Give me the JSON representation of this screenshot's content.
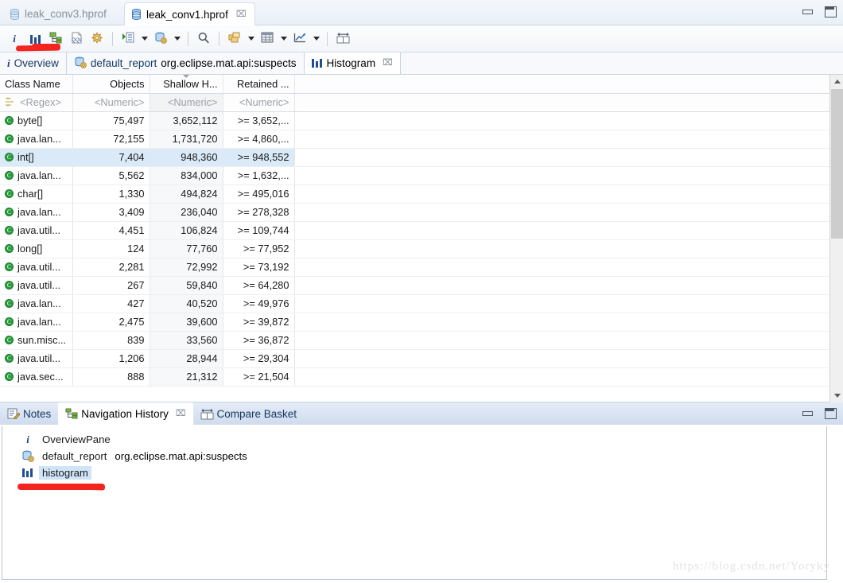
{
  "window": {
    "minimize_label": "Minimize",
    "maximize_label": "Maximize"
  },
  "editor_tabs": [
    {
      "label": "leak_conv3.hprof",
      "icon": "heap-dump-icon",
      "active": false,
      "closable": false
    },
    {
      "label": "leak_conv1.hprof",
      "icon": "heap-dump-icon",
      "active": true,
      "closable": true,
      "close_glyph": "⌧"
    }
  ],
  "toolbar": {
    "items": [
      {
        "name": "overview-info-button",
        "icon": "info-icon",
        "label": "i",
        "pressed": false,
        "dropdown": false
      },
      {
        "name": "histogram-button",
        "icon": "histogram-icon",
        "label": "Histogram",
        "pressed": false,
        "dropdown": false
      },
      {
        "name": "dominator-tree-button",
        "icon": "dominator-tree-icon",
        "label": "Dominator Tree",
        "pressed": false,
        "dropdown": false
      },
      {
        "name": "oql-button",
        "icon": "oql-icon",
        "label": "OQL",
        "pressed": false,
        "dropdown": false
      },
      {
        "name": "calculate-button",
        "icon": "gear-icon",
        "label": "Calculate Precise Retained Size",
        "pressed": false,
        "dropdown": false
      },
      {
        "name": "run-report-button",
        "icon": "run-expert-system-icon",
        "label": "Run Expert System Test",
        "pressed": false,
        "dropdown": true
      },
      {
        "name": "query-browser-button",
        "icon": "query-browser-icon",
        "label": "Query Browser",
        "pressed": false,
        "dropdown": true
      },
      {
        "name": "find-button",
        "icon": "search-icon",
        "label": "Find",
        "pressed": false,
        "dropdown": false
      },
      {
        "name": "group-by-button",
        "icon": "group-by-icon",
        "label": "Group By",
        "pressed": false,
        "dropdown": true
      },
      {
        "name": "export-table-button",
        "icon": "export-table-icon",
        "label": "Export",
        "pressed": false,
        "dropdown": true
      },
      {
        "name": "chart-button",
        "icon": "chart-icon",
        "label": "Chart",
        "pressed": false,
        "dropdown": true
      },
      {
        "name": "compare-button",
        "icon": "compare-basket-icon",
        "label": "Compare",
        "pressed": false,
        "dropdown": false
      }
    ]
  },
  "view_tabs": [
    {
      "label": "Overview",
      "icon": "info-icon",
      "active": false,
      "closable": false,
      "sub": ""
    },
    {
      "label": "default_report",
      "sub": "org.eclipse.mat.api:suspects",
      "icon": "report-icon",
      "active": false,
      "closable": false
    },
    {
      "label": "Histogram",
      "sub": "",
      "icon": "histogram-icon",
      "active": true,
      "closable": true,
      "close_glyph": "⌧"
    }
  ],
  "table": {
    "columns": [
      {
        "key": "class_name",
        "header": "Class Name",
        "align": "left",
        "filter": "<Regex>",
        "filter_icon": "regex-filter-icon",
        "sorted": false
      },
      {
        "key": "objects",
        "header": "Objects",
        "align": "right",
        "filter": "<Numeric>",
        "sorted": false
      },
      {
        "key": "shallow_heap",
        "header": "Shallow H...",
        "align": "right",
        "filter": "<Numeric>",
        "sorted": true,
        "sort_dir": "desc"
      },
      {
        "key": "retained_heap",
        "header": "Retained ...",
        "align": "right",
        "filter": "<Numeric>",
        "sorted": false
      },
      {
        "key": "spacer",
        "header": "",
        "align": "left",
        "filter": "",
        "sorted": false
      }
    ],
    "rows": [
      {
        "icon": "class-icon",
        "class_name": "byte[]",
        "objects": "75,497",
        "shallow_heap": "3,652,112",
        "retained_heap": ">= 3,652,...",
        "selected": false
      },
      {
        "icon": "class-icon",
        "class_name": "java.lan...",
        "objects": "72,155",
        "shallow_heap": "1,731,720",
        "retained_heap": ">= 4,860,...",
        "selected": false
      },
      {
        "icon": "class-icon",
        "class_name": "int[]",
        "objects": "7,404",
        "shallow_heap": "948,360",
        "retained_heap": ">= 948,552",
        "selected": true
      },
      {
        "icon": "class-icon",
        "class_name": "java.lan...",
        "objects": "5,562",
        "shallow_heap": "834,000",
        "retained_heap": ">= 1,632,...",
        "selected": false
      },
      {
        "icon": "class-icon",
        "class_name": "char[]",
        "objects": "1,330",
        "shallow_heap": "494,824",
        "retained_heap": ">= 495,016",
        "selected": false
      },
      {
        "icon": "class-icon",
        "class_name": "java.lan...",
        "objects": "3,409",
        "shallow_heap": "236,040",
        "retained_heap": ">= 278,328",
        "selected": false
      },
      {
        "icon": "class-icon",
        "class_name": "java.util...",
        "objects": "4,451",
        "shallow_heap": "106,824",
        "retained_heap": ">= 109,744",
        "selected": false
      },
      {
        "icon": "class-icon",
        "class_name": "long[]",
        "objects": "124",
        "shallow_heap": "77,760",
        "retained_heap": ">= 77,952",
        "selected": false
      },
      {
        "icon": "class-icon",
        "class_name": "java.util...",
        "objects": "2,281",
        "shallow_heap": "72,992",
        "retained_heap": ">= 73,192",
        "selected": false
      },
      {
        "icon": "class-icon",
        "class_name": "java.util...",
        "objects": "267",
        "shallow_heap": "59,840",
        "retained_heap": ">= 64,280",
        "selected": false
      },
      {
        "icon": "class-icon",
        "class_name": "java.lan...",
        "objects": "427",
        "shallow_heap": "40,520",
        "retained_heap": ">= 49,976",
        "selected": false
      },
      {
        "icon": "class-icon",
        "class_name": "java.lan...",
        "objects": "2,475",
        "shallow_heap": "39,600",
        "retained_heap": ">= 39,872",
        "selected": false
      },
      {
        "icon": "class-icon",
        "class_name": "sun.misc...",
        "objects": "839",
        "shallow_heap": "33,560",
        "retained_heap": ">= 36,872",
        "selected": false
      },
      {
        "icon": "class-icon",
        "class_name": "java.util...",
        "objects": "1,206",
        "shallow_heap": "28,944",
        "retained_heap": ">= 29,304",
        "selected": false
      },
      {
        "icon": "class-icon",
        "class_name": "java.sec...",
        "objects": "888",
        "shallow_heap": "21,312",
        "retained_heap": ">= 21,504",
        "selected": false
      }
    ]
  },
  "scrollbar": {
    "up_glyph": "▲",
    "down_glyph": "▼"
  },
  "bottom_tabs": [
    {
      "label": "Notes",
      "icon": "notes-icon",
      "active": false,
      "closable": false
    },
    {
      "label": "Navigation History",
      "icon": "navigation-history-icon",
      "active": true,
      "closable": true,
      "close_glyph": "⌧"
    },
    {
      "label": "Compare Basket",
      "icon": "compare-basket-icon",
      "active": false,
      "closable": false
    }
  ],
  "navigation_history": [
    {
      "icon": "info-icon",
      "label": "OverviewPane",
      "sub": "",
      "selected": false
    },
    {
      "icon": "report-icon",
      "label": "default_report",
      "sub": "org.eclipse.mat.api:suspects",
      "selected": false
    },
    {
      "icon": "histogram-icon",
      "label": "histogram",
      "sub": "",
      "selected": true
    }
  ],
  "watermark": "https://blog.csdn.net/Yoryky",
  "colors": {
    "accent": "#1f4e8c",
    "selection": "#dbeaf8",
    "annotation": "#f4241f",
    "class_icon": "#2a9c3c"
  }
}
